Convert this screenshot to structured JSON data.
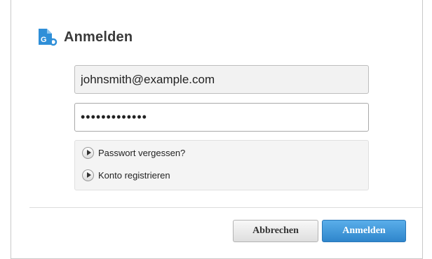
{
  "dialog": {
    "title": "Anmelden",
    "logo_icon": "app-logo-icon"
  },
  "form": {
    "email_value": "johnsmith@example.com",
    "password_value": "•••••••••••••"
  },
  "links": [
    {
      "label": "Passwort vergessen?",
      "icon": "play-arrow-icon"
    },
    {
      "label": "Konto registrieren",
      "icon": "play-arrow-icon"
    }
  ],
  "buttons": {
    "cancel_label": "Abbrechen",
    "login_label": "Anmelden"
  },
  "colors": {
    "primary": "#3d96dd",
    "logo": "#2f8fd8"
  }
}
